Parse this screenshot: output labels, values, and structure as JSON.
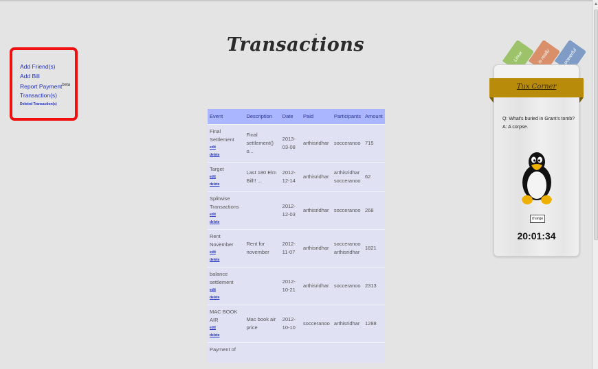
{
  "page": {
    "title": "Transactions"
  },
  "menu": {
    "add_friends": "Add Friend(s)",
    "add_bill": "Add Bill",
    "report_payment": "Report Payment",
    "report_payment_badge": "beta",
    "transactions": "Transaction(s)",
    "deleted_transactions": "Deleted Transaction(s)"
  },
  "table": {
    "headers": [
      "Event",
      "Description",
      "Date",
      "Paid",
      "Participants",
      "Amount"
    ],
    "edit_label": "edit",
    "delete_label": "delete",
    "rows": [
      {
        "event": "Final Settlement",
        "description": "Final settlement() o...",
        "date": "2013-03-08",
        "paid": "arthisridhar",
        "participants": "socceranoo",
        "amount": "715"
      },
      {
        "event": "Target",
        "description": "Last 180 Elm Bill!! ...",
        "date": "2012-12-14",
        "paid": "arthisridhar",
        "participants": "arthisridhar socceranoo",
        "amount": "62"
      },
      {
        "event": "Splitwise Transactions",
        "description": "",
        "date": "2012-12-03",
        "paid": "arthisridhar",
        "participants": "socceranoo",
        "amount": "268"
      },
      {
        "event": "Rent November",
        "description": "Rent for november",
        "date": "2012-11-07",
        "paid": "arthisridhar",
        "participants": "socceranoo arthisridhar",
        "amount": "1821"
      },
      {
        "event": "balance settlement",
        "description": "",
        "date": "2012-10-21",
        "paid": "arthisridhar",
        "participants": "socceranoo",
        "amount": "2313"
      },
      {
        "event": "MAC BOOK AIR",
        "description": "Mac book air price",
        "date": "2012-10-10",
        "paid": "socceranoo",
        "participants": "arthisridhar",
        "amount": "1288"
      },
      {
        "event": "Payment of",
        "description": "",
        "date": "",
        "paid": "",
        "participants": "",
        "amount": ""
      }
    ]
  },
  "sidebar": {
    "tabs": [
      {
        "label": "Linux",
        "color": "#9cc36a"
      },
      {
        "label": "is really",
        "color": "#d98f6a"
      },
      {
        "label": "powerful",
        "color": "#7f9cc6"
      }
    ],
    "title": "Tux Corner",
    "question": "Q: What's buried in Grant's tomb?",
    "answer": "A: A corpse.",
    "change_label": "change",
    "clock": "20:01:34",
    "ribbon_color": "#b98b0a"
  }
}
